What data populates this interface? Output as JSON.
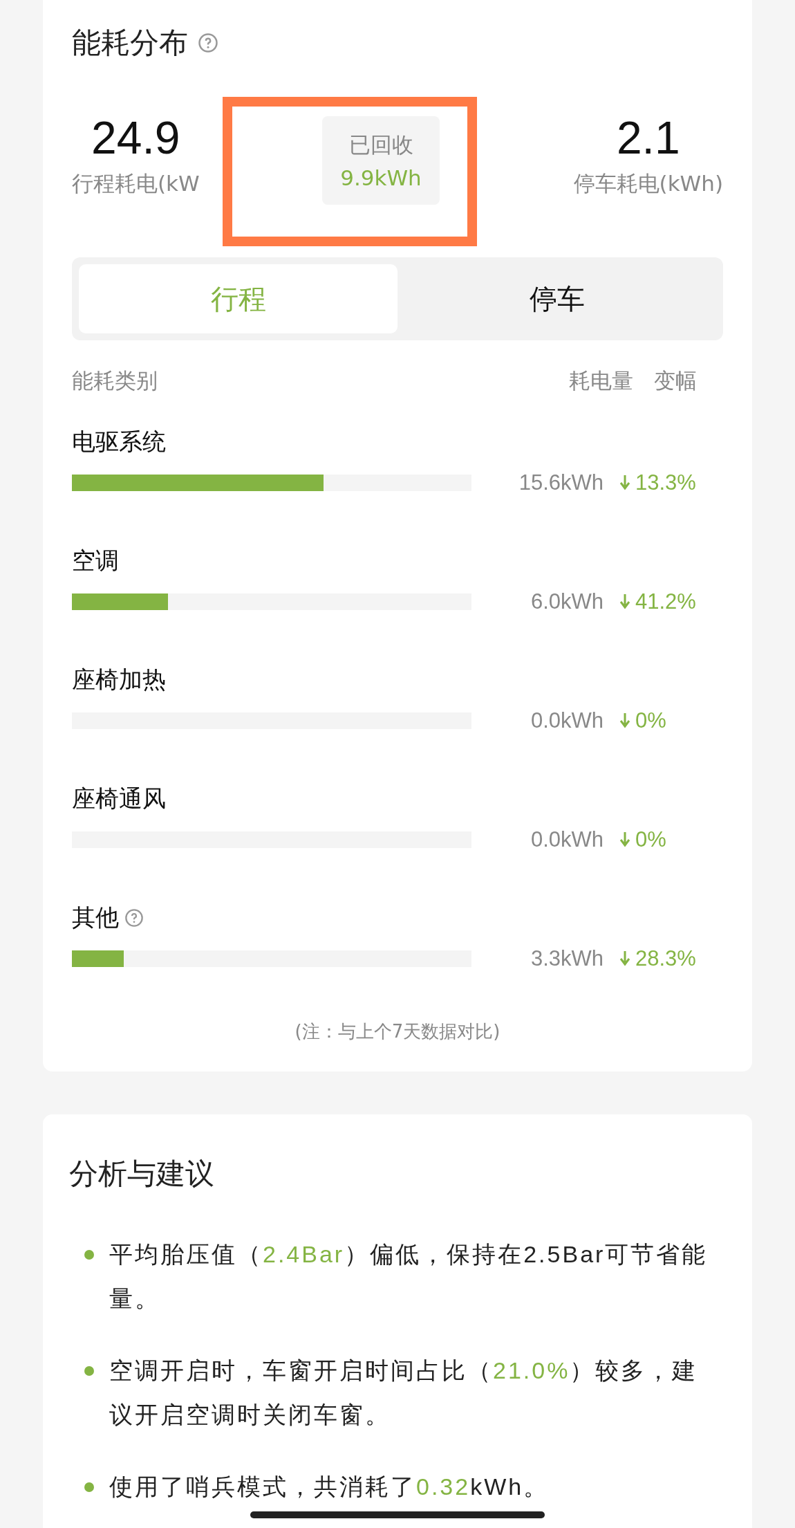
{
  "energy_card": {
    "title": "能耗分布",
    "trip_stat": {
      "value": "24.9",
      "label": "行程耗电(kW"
    },
    "recovered_tooltip": {
      "label": "已回收",
      "value": "9.9kWh"
    },
    "parking_stat": {
      "value": "2.1",
      "label": "停车耗电(kWh)"
    },
    "tabs": [
      {
        "label": "行程",
        "selected": true
      },
      {
        "label": "停车",
        "selected": false
      }
    ],
    "columns": [
      "能耗类别",
      "耗电量",
      "变幅"
    ],
    "rows": [
      {
        "name": "电驱系统",
        "level": 0.63,
        "amount": "15.6kWh",
        "change": "13.3%",
        "help": false
      },
      {
        "name": "空调",
        "level": 0.24,
        "amount": "6.0kWh",
        "change": "41.2%",
        "help": false
      },
      {
        "name": "座椅加热",
        "amount": "0.0kWh",
        "change": "0%",
        "help": false
      },
      {
        "name": "座椅通风",
        "amount": "0.0kWh",
        "change": "0%",
        "help": false
      },
      {
        "name": "其他",
        "level": 0.13,
        "amount": "3.3kWh",
        "change": "28.3%",
        "help": true
      }
    ],
    "note": "(注：与上个7天数据对比)"
  },
  "analysis_card": {
    "title": "分析与建议",
    "items": [
      [
        {
          "text": "平均胎压值（",
          "highlight": false
        },
        {
          "text": "2.4Bar",
          "highlight": true
        },
        {
          "text": "）偏低，保持在2.5Bar可节省能量。",
          "highlight": false
        }
      ],
      [
        {
          "text": "空调开启时，车窗开启时间占比（",
          "highlight": false
        },
        {
          "text": "21.0%",
          "highlight": true
        },
        {
          "text": "）较多，建议开启空调时关闭车窗。",
          "highlight": false
        }
      ],
      [
        {
          "text": "使用了哨兵模式，共消耗了",
          "highlight": false
        },
        {
          "text": "0.32",
          "highlight": true
        },
        {
          "text": "kWh。",
          "highlight": false
        }
      ]
    ]
  }
}
